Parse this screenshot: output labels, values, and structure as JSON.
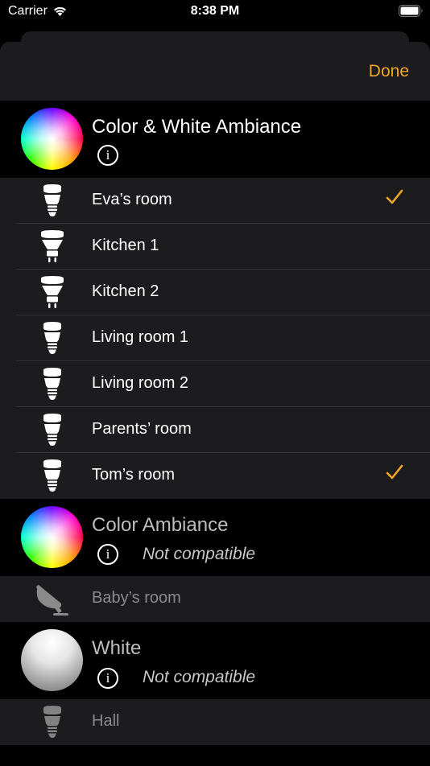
{
  "status": {
    "carrier": "Carrier",
    "time": "8:38 PM"
  },
  "nav": {
    "done_label": "Done"
  },
  "accent": "#f5a623",
  "sections": [
    {
      "title": "Color & White Ambiance",
      "info": "i",
      "lights": [
        {
          "name": "Eva’s room",
          "icon": "bulb-icon",
          "selected": true
        },
        {
          "name": "Kitchen 1",
          "icon": "spot-bulb-icon",
          "selected": false
        },
        {
          "name": "Kitchen 2",
          "icon": "spot-bulb-icon",
          "selected": false
        },
        {
          "name": "Living room 1",
          "icon": "bulb-icon",
          "selected": false
        },
        {
          "name": "Living room 2",
          "icon": "bulb-icon",
          "selected": false
        },
        {
          "name": "Parents’ room",
          "icon": "bulb-icon",
          "selected": false
        },
        {
          "name": "Tom’s room",
          "icon": "bulb-icon",
          "selected": true
        }
      ]
    },
    {
      "title": "Color Ambiance",
      "info": "i",
      "status": "Not compatible",
      "lights": [
        {
          "name": "Baby’s room",
          "icon": "lamp-icon"
        }
      ]
    },
    {
      "title": "White",
      "info": "i",
      "status": "Not compatible",
      "lights": [
        {
          "name": "Hall",
          "icon": "bulb-icon"
        }
      ]
    }
  ]
}
